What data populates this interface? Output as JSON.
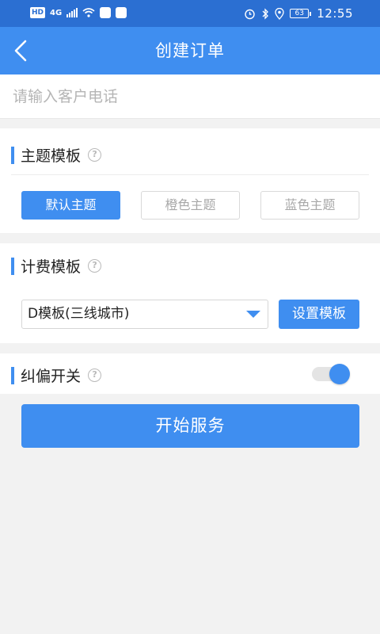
{
  "status_bar": {
    "left_badge": "HD",
    "network": "4G",
    "time": "12:55",
    "battery": "63",
    "icons": [
      "hd-badge",
      "signal-icon",
      "wifi-icon",
      "app-notification-icon",
      "app-notification-icon",
      "alarm-icon",
      "bluetooth-icon",
      "location-icon",
      "battery-icon"
    ]
  },
  "header": {
    "title": "创建订单",
    "back_icon": "chevron-left-icon"
  },
  "phone": {
    "placeholder": "请输入客户电话",
    "value": ""
  },
  "theme_section": {
    "title": "主题模板",
    "help_icon": "question-circle-icon",
    "options": [
      {
        "label": "默认主题",
        "selected": true
      },
      {
        "label": "橙色主题",
        "selected": false
      },
      {
        "label": "蓝色主题",
        "selected": false
      }
    ]
  },
  "billing_section": {
    "title": "计费模板",
    "help_icon": "question-circle-icon",
    "selected_template": "D模板(三线城市)",
    "set_button": "设置模板"
  },
  "correction_section": {
    "title": "纠偏开关",
    "help_icon": "question-circle-icon",
    "enabled": true
  },
  "start_button": "开始服务",
  "colors": {
    "status_bar": "#2b6fd2",
    "primary": "#3f8ef0",
    "background": "#f2f2f2"
  }
}
